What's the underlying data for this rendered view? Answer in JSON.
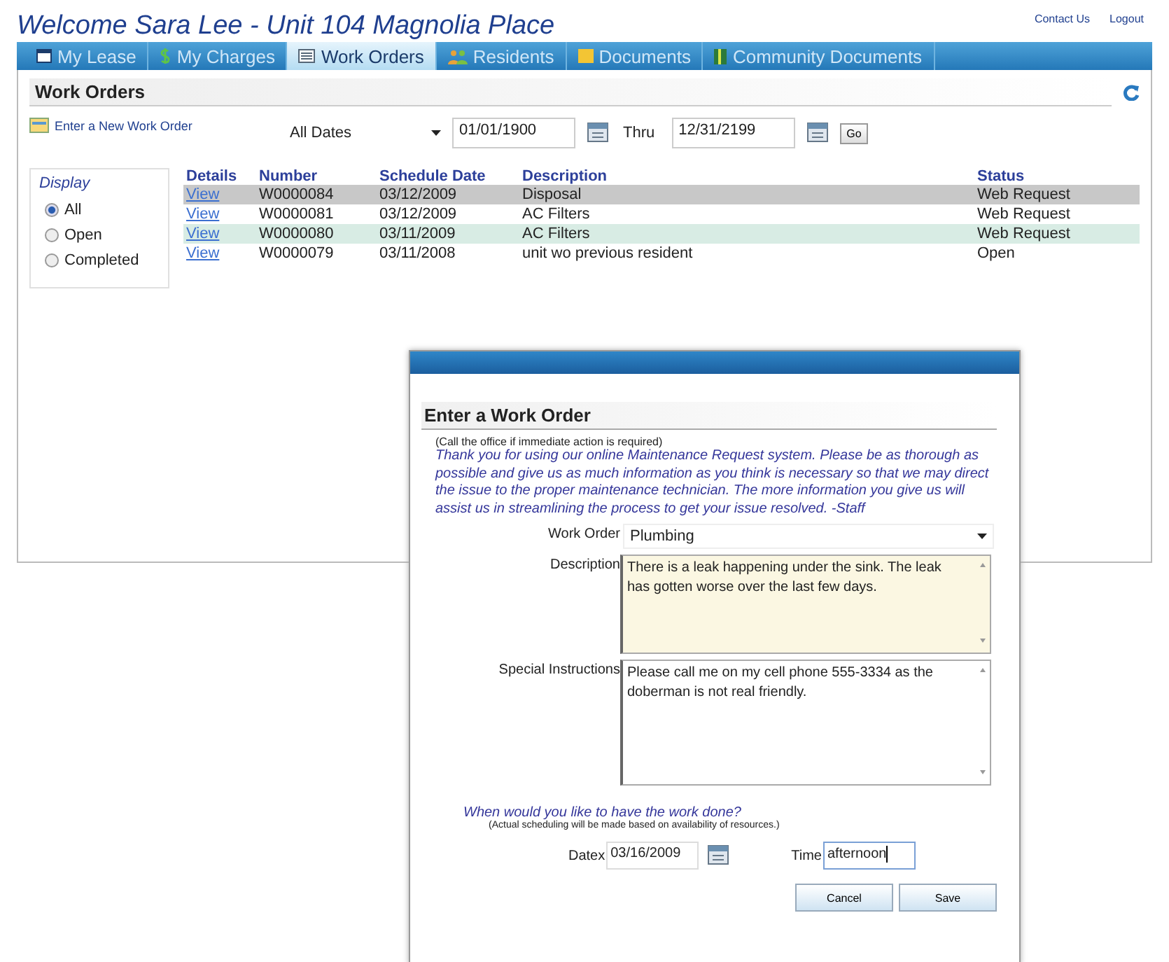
{
  "header": {
    "title": "Welcome Sara Lee - Unit 104 Magnolia Place",
    "links": [
      "Contact Us",
      "Logout"
    ]
  },
  "tabs": [
    {
      "label": "My Lease",
      "selected": false
    },
    {
      "label": "My Charges",
      "selected": false
    },
    {
      "label": "Work Orders",
      "selected": true
    },
    {
      "label": "Residents",
      "selected": false
    },
    {
      "label": "Documents",
      "selected": false
    },
    {
      "label": "Community Documents",
      "selected": false
    }
  ],
  "panel": {
    "title": "Work Orders",
    "new_link": "Enter a New Work Order",
    "range": "All Dates",
    "from": "01/01/1900",
    "thru_label": "Thru",
    "to": "12/31/2199",
    "go": "Go"
  },
  "display": {
    "title": "Display",
    "options": [
      {
        "label": "All",
        "selected": true
      },
      {
        "label": "Open",
        "selected": false
      },
      {
        "label": "Completed",
        "selected": false
      }
    ]
  },
  "table": {
    "columns": [
      "Details",
      "Number",
      "Schedule Date",
      "Description",
      "Status"
    ],
    "rows": [
      {
        "link": "View",
        "number": "W0000084",
        "date": "03/12/2009",
        "description": "Disposal",
        "status": "Web Request",
        "selected": true,
        "hovered": false
      },
      {
        "link": "View",
        "number": "W0000081",
        "date": "03/12/2009",
        "description": "AC Filters",
        "status": "Web Request",
        "selected": false,
        "hovered": false
      },
      {
        "link": "View",
        "number": "W0000080",
        "date": "03/11/2009",
        "description": "AC Filters",
        "status": "Web Request",
        "selected": false,
        "hovered": true
      },
      {
        "link": "View",
        "number": "W0000079",
        "date": "03/11/2008",
        "description": "unit wo previous resident",
        "status": "Open",
        "selected": false,
        "hovered": false
      }
    ]
  },
  "dialog": {
    "title": "Enter a Work Order",
    "note": "(Call the office if immediate action is required)",
    "intro": "Thank you for using our online Maintenance Request system. Please be as thorough as possible and give us as much information as you think is necessary so that we may direct the issue to the proper maintenance technician. The more information you give us will assist us in streamlining the process to get your issue resolved. -Staff",
    "work_order": {
      "label": "Work Order",
      "value": "Plumbing"
    },
    "fields": [
      {
        "label": "Description",
        "value": "There is a leak happening under the sink.  The leak has gotten worse over the last few days.",
        "highlighted": true
      },
      {
        "label": "Special Instructions",
        "value": "Please call me on my cell phone 555-3334 as the doberman is not real friendly.",
        "highlighted": false
      }
    ],
    "when": "When would you like to have the work done?",
    "when_note": "(Actual scheduling will be made based on availability of resources.)",
    "date": {
      "label": "Datex",
      "value": "03/16/2009"
    },
    "time": {
      "label": "Time",
      "value": "afternoon"
    },
    "buttons": [
      "Cancel",
      "Save"
    ]
  }
}
